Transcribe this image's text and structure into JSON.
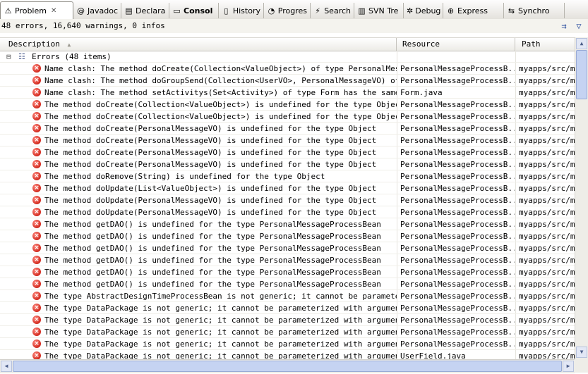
{
  "tabs": [
    {
      "label": "Problem",
      "icon": "problems-icon",
      "glyph": "⚠",
      "close": "✕",
      "active": true
    },
    {
      "label": "Javadoc",
      "icon": "javadoc-icon",
      "glyph": "@"
    },
    {
      "label": "Declara",
      "icon": "declaration-icon",
      "glyph": "▤"
    },
    {
      "label": "Consol",
      "icon": "console-icon",
      "glyph": "▭",
      "bold": true
    },
    {
      "label": "History",
      "icon": "history-icon",
      "glyph": "▯"
    },
    {
      "label": "Progres",
      "icon": "progress-icon",
      "glyph": "◔"
    },
    {
      "label": "Search",
      "icon": "search-icon",
      "glyph": "⚡"
    },
    {
      "label": "SVN Tre",
      "icon": "svn-tree-icon",
      "glyph": "▥"
    },
    {
      "label": "Debug",
      "icon": "debug-icon",
      "glyph": "✲"
    },
    {
      "label": "Express",
      "icon": "expressions-icon",
      "glyph": "⊕"
    },
    {
      "label": "Synchro",
      "icon": "synchronize-icon",
      "glyph": "⇆"
    }
  ],
  "status": {
    "summary": "48 errors, 16,640 warnings, 0 infos",
    "toolbar": [
      {
        "name": "filter-icon",
        "glyph": "⇉"
      },
      {
        "name": "view-menu-icon",
        "glyph": "▽"
      }
    ]
  },
  "columns": {
    "description": "Description",
    "sort_indicator": "▲",
    "resource": "Resource",
    "path": "Path"
  },
  "group": {
    "toggle": "⊟",
    "label": "Errors (48 items)"
  },
  "error_glyph": "×",
  "rows": [
    {
      "description": "Name clash: The method doCreate(Collection<ValueObject>) of type PersonalMessageProcessBean has the same erasure",
      "resource": "PersonalMessageProcessB...",
      "path": "myapps/src/main"
    },
    {
      "description": "Name clash: The method doGroupSend(Collection<UserVO>, PersonalMessageVO) of type PersonalMessageProcessBean",
      "resource": "PersonalMessageProcessB...",
      "path": "myapps/src/main"
    },
    {
      "description": "Name clash: The method setActivitys(Set<Activity>) of type Form has the same erasure",
      "resource": "Form.java",
      "path": "myapps/src/main"
    },
    {
      "description": "The method doCreate(Collection<ValueObject>) is undefined for the type Object",
      "resource": "PersonalMessageProcessB...",
      "path": "myapps/src/main"
    },
    {
      "description": "The method doCreate(Collection<ValueObject>) is undefined for the type Object",
      "resource": "PersonalMessageProcessB...",
      "path": "myapps/src/main"
    },
    {
      "description": "The method doCreate(PersonalMessageVO) is undefined for the type Object",
      "resource": "PersonalMessageProcessB...",
      "path": "myapps/src/main"
    },
    {
      "description": "The method doCreate(PersonalMessageVO) is undefined for the type Object",
      "resource": "PersonalMessageProcessB...",
      "path": "myapps/src/main"
    },
    {
      "description": "The method doCreate(PersonalMessageVO) is undefined for the type Object",
      "resource": "PersonalMessageProcessB...",
      "path": "myapps/src/main"
    },
    {
      "description": "The method doCreate(PersonalMessageVO) is undefined for the type Object",
      "resource": "PersonalMessageProcessB...",
      "path": "myapps/src/main"
    },
    {
      "description": "The method doRemove(String) is undefined for the type Object",
      "resource": "PersonalMessageProcessB...",
      "path": "myapps/src/main"
    },
    {
      "description": "The method doUpdate(List<ValueObject>) is undefined for the type Object",
      "resource": "PersonalMessageProcessB...",
      "path": "myapps/src/main"
    },
    {
      "description": "The method doUpdate(PersonalMessageVO) is undefined for the type Object",
      "resource": "PersonalMessageProcessB...",
      "path": "myapps/src/main"
    },
    {
      "description": "The method doUpdate(PersonalMessageVO) is undefined for the type Object",
      "resource": "PersonalMessageProcessB...",
      "path": "myapps/src/main"
    },
    {
      "description": "The method getDAO() is undefined for the type PersonalMessageProcessBean",
      "resource": "PersonalMessageProcessB...",
      "path": "myapps/src/main"
    },
    {
      "description": "The method getDAO() is undefined for the type PersonalMessageProcessBean",
      "resource": "PersonalMessageProcessB...",
      "path": "myapps/src/main"
    },
    {
      "description": "The method getDAO() is undefined for the type PersonalMessageProcessBean",
      "resource": "PersonalMessageProcessB...",
      "path": "myapps/src/main"
    },
    {
      "description": "The method getDAO() is undefined for the type PersonalMessageProcessBean",
      "resource": "PersonalMessageProcessB...",
      "path": "myapps/src/main"
    },
    {
      "description": "The method getDAO() is undefined for the type PersonalMessageProcessBean",
      "resource": "PersonalMessageProcessB...",
      "path": "myapps/src/main"
    },
    {
      "description": "The method getDAO() is undefined for the type PersonalMessageProcessBean",
      "resource": "PersonalMessageProcessB...",
      "path": "myapps/src/main"
    },
    {
      "description": "The type AbstractDesignTimeProcessBean is not generic; it cannot be parameterized with arguments",
      "resource": "PersonalMessageProcessB...",
      "path": "myapps/src/main"
    },
    {
      "description": "The type DataPackage is not generic; it cannot be parameterized with arguments <PersonalMessageVO>",
      "resource": "PersonalMessageProcessB...",
      "path": "myapps/src/main"
    },
    {
      "description": "The type DataPackage is not generic; it cannot be parameterized with arguments <PersonalMessageVO>",
      "resource": "PersonalMessageProcessB...",
      "path": "myapps/src/main"
    },
    {
      "description": "The type DataPackage is not generic; it cannot be parameterized with arguments <PersonalMessageVO>",
      "resource": "PersonalMessageProcessB...",
      "path": "myapps/src/main"
    },
    {
      "description": "The type DataPackage is not generic; it cannot be parameterized with arguments <PersonalMessageVO>",
      "resource": "PersonalMessageProcessB...",
      "path": "myapps/src/main"
    },
    {
      "description": "The type DataPackage is not generic; it cannot be parameterized with arguments <UserVO>",
      "resource": "UserField.java",
      "path": "myapps/src/main"
    }
  ],
  "scroll": {
    "up": "▲",
    "down": "▼",
    "left": "◀",
    "right": "▶"
  }
}
